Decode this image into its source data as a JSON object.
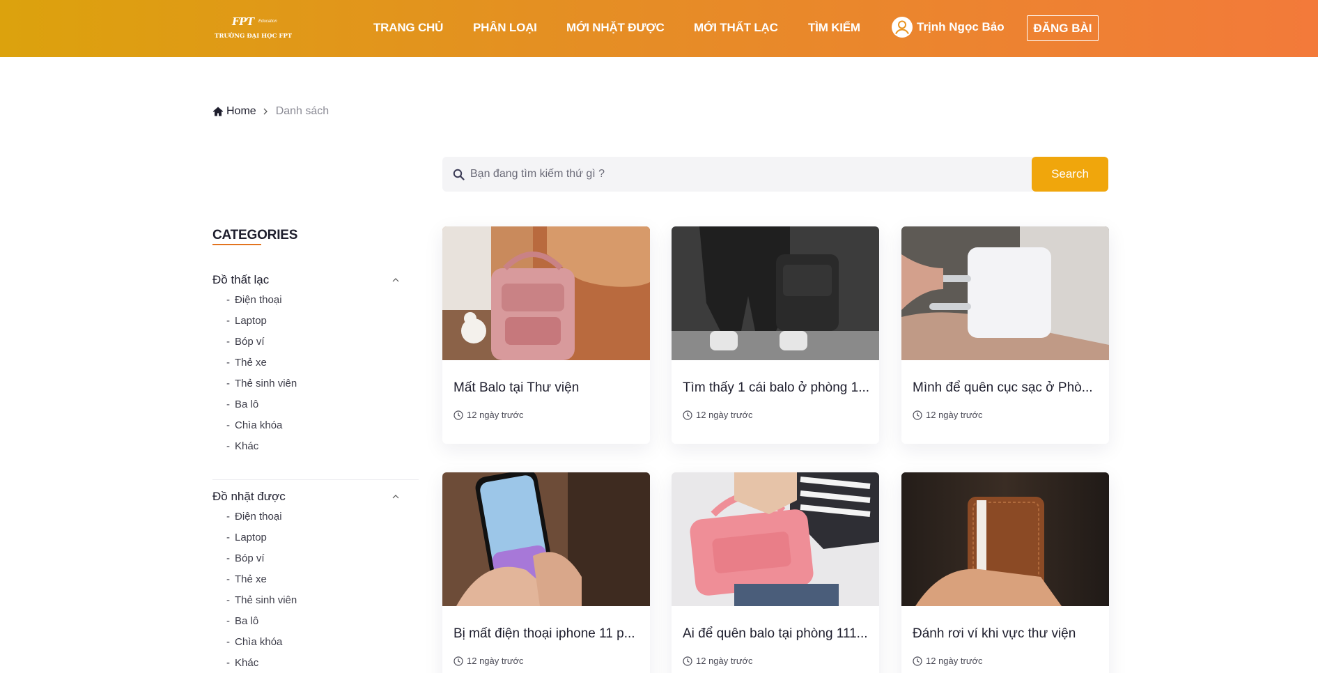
{
  "header": {
    "logo": {
      "brand": "FPT",
      "sub": "Education",
      "school": "TRƯỜNG ĐẠI HỌC FPT"
    },
    "nav": [
      {
        "label": "TRANG CHỦ"
      },
      {
        "label": "PHÂN LOẠI"
      },
      {
        "label": "MỚI NHẶT ĐƯỢC"
      },
      {
        "label": "MỚI THẤT LẠC"
      },
      {
        "label": "TÌM KIẾM"
      }
    ],
    "user": {
      "name": "Trịnh Ngọc Bảo",
      "icon": "user-circle-icon"
    },
    "post_button": "ĐĂNG BÀI",
    "gradient": [
      "#dca20d",
      "#f37a3a"
    ]
  },
  "breadcrumb": {
    "home": "Home",
    "current": "Danh sách"
  },
  "search": {
    "placeholder": "Bạn đang tìm kiếm thứ gì ?",
    "button": "Search",
    "accent": "#f0a60c"
  },
  "sidebar": {
    "title": "CATEGORIES",
    "groups": [
      {
        "label": "Đồ thất lạc",
        "items": [
          "Điện thoại",
          "Laptop",
          "Bóp ví",
          "Thẻ xe",
          "Thẻ sinh viên",
          "Ba lô",
          "Chìa khóa",
          "Khác"
        ]
      },
      {
        "label": "Đồ nhặt được",
        "items": [
          "Điện thoại",
          "Laptop",
          "Bóp ví",
          "Thẻ xe",
          "Thẻ sinh viên",
          "Ba lô",
          "Chìa khóa",
          "Khác"
        ]
      }
    ]
  },
  "posts": [
    {
      "title": "Mất Balo tại Thư viện",
      "time": "12 ngày trước",
      "image": "pink-backpack-photo"
    },
    {
      "title": "Tìm thấy 1 cái balo ở phòng 1...",
      "time": "12 ngày trước",
      "image": "black-backpack-photo"
    },
    {
      "title": "Mình để quên cục sạc ở Phò...",
      "time": "12 ngày trước",
      "image": "white-charger-photo"
    },
    {
      "title": "Bị mất điện thoại iphone 11 p...",
      "time": "12 ngày trước",
      "image": "iphone-photo"
    },
    {
      "title": "Ai để quên balo tại phòng 111...",
      "time": "12 ngày trước",
      "image": "pink-bag-photo"
    },
    {
      "title": "Đánh rơi ví khi vực thư viện",
      "time": "12 ngày trước",
      "image": "brown-wallet-photo"
    }
  ]
}
